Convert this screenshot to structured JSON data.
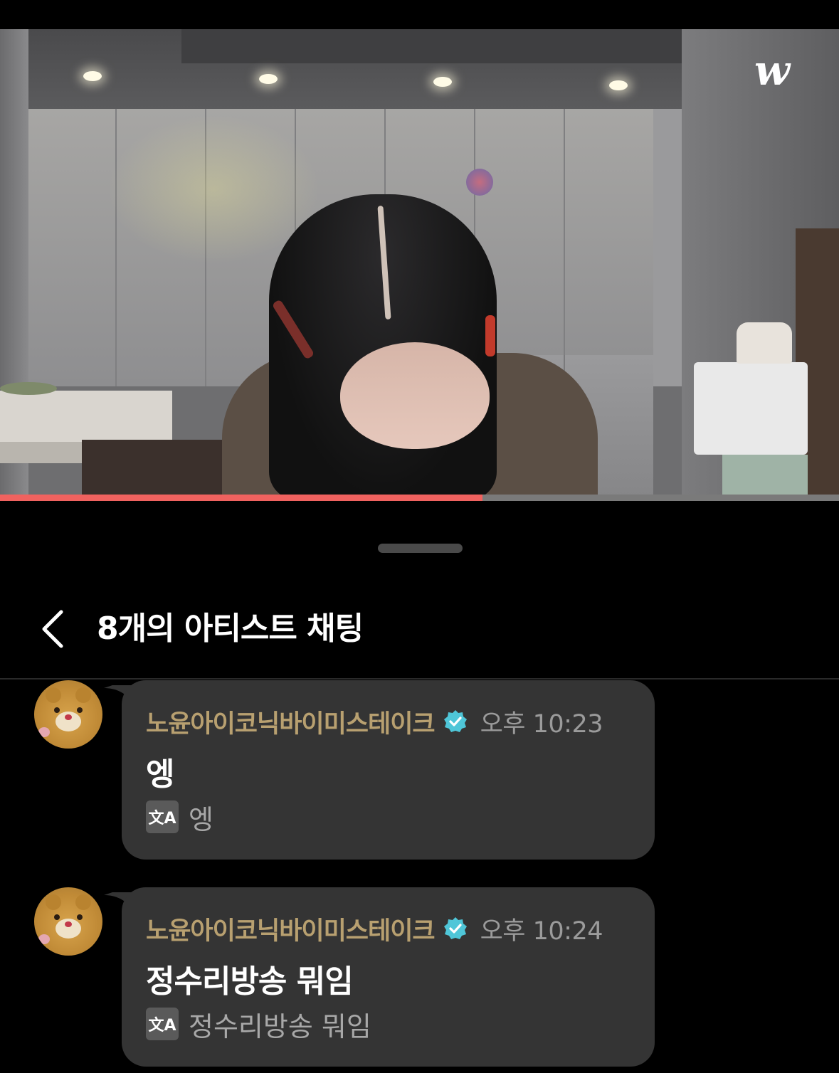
{
  "video": {
    "logo_text": "w",
    "progress": 0.575,
    "progress_color": "#f0625f"
  },
  "sheet": {
    "title": "8개의 아티스트 채팅",
    "back_icon": "chevron-left-icon"
  },
  "messages": [
    {
      "author": "노윤아이코닉바이미스테이크",
      "verified": true,
      "time": "오후 10:23",
      "text": "엥",
      "translate_icon_text": "文A",
      "translation": "엥"
    },
    {
      "author": "노윤아이코닉바이미스테이크",
      "verified": true,
      "time": "오후 10:24",
      "text": "정수리방송 뭐임",
      "translate_icon_text": "文A",
      "translation": "정수리방송 뭐임"
    }
  ],
  "colors": {
    "name": "#b8a070",
    "bubble": "#343434",
    "verified": "#4fc6d8"
  }
}
